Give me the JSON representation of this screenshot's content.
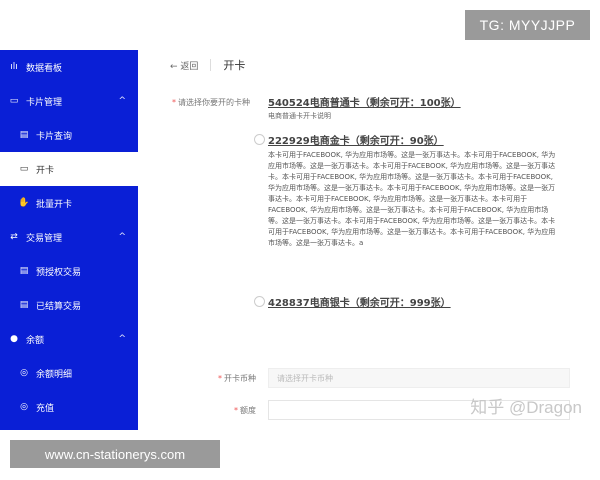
{
  "badges": {
    "tg": "TG: MYYJJPP",
    "site": "www.cn-stationerys.com",
    "watermark": "知乎 @Dragon"
  },
  "sidebar": {
    "items": [
      {
        "label": "数据看板",
        "icon": "chart-icon",
        "level": 0,
        "active": false,
        "chevron": false
      },
      {
        "label": "卡片管理",
        "icon": "card-icon",
        "level": 0,
        "active": false,
        "chevron": true
      },
      {
        "label": "卡片查询",
        "icon": "doc-icon",
        "level": 1,
        "active": false,
        "chevron": false
      },
      {
        "label": "开卡",
        "icon": "card-icon",
        "level": 1,
        "active": true,
        "chevron": false
      },
      {
        "label": "批量开卡",
        "icon": "hand-icon",
        "level": 1,
        "active": false,
        "chevron": false
      },
      {
        "label": "交易管理",
        "icon": "swap-icon",
        "level": 0,
        "active": false,
        "chevron": true
      },
      {
        "label": "预授权交易",
        "icon": "doc-icon",
        "level": 1,
        "active": false,
        "chevron": false
      },
      {
        "label": "已结算交易",
        "icon": "doc-icon",
        "level": 1,
        "active": false,
        "chevron": false
      },
      {
        "label": "余额",
        "icon": "dot-icon",
        "level": 0,
        "active": false,
        "chevron": true
      },
      {
        "label": "余额明细",
        "icon": "circle-icon",
        "level": 1,
        "active": false,
        "chevron": false
      },
      {
        "label": "充值",
        "icon": "circle-icon",
        "level": 1,
        "active": false,
        "chevron": false
      }
    ]
  },
  "header": {
    "back": "← 返回",
    "title": "开卡"
  },
  "form": {
    "card_type_label": "请选择你要开的卡种",
    "options": [
      {
        "title": "540524电商普通卡（剩余可开：100张）",
        "desc": "电商普通卡开卡说明"
      },
      {
        "title": "222929电商金卡（剩余可开：90张）",
        "desc": "本卡可用于FACEBOOK, 华为应用市场等。这是一张万事达卡。本卡可用于FACEBOOK, 华为应用市场等。这是一张万事达卡。本卡可用于FACEBOOK, 华为应用市场等。这是一张万事达卡。本卡可用于FACEBOOK, 华为应用市场等。这是一张万事达卡。本卡可用于FACEBOOK, 华为应用市场等。这是一张万事达卡。本卡可用于FACEBOOK, 华为应用市场等。这是一张万事达卡。本卡可用于FACEBOOK, 华为应用市场等。这是一张万事达卡。本卡可用于FACEBOOK, 华为应用市场等。这是一张万事达卡。本卡可用于FACEBOOK, 华为应用市场等。这是一张万事达卡。本卡可用于FACEBOOK, 华为应用市场等。这是一张万事达卡。本卡可用于FACEBOOK, 华为应用市场等。这是一张万事达卡。本卡可用于FACEBOOK, 华为应用市场等。这是一张万事达卡。a"
      },
      {
        "title": "428837电商银卡（剩余可开：999张）",
        "desc": ""
      }
    ],
    "currency_label": "开卡币种",
    "currency_placeholder": "请选择开卡币种",
    "amount_label": "额度"
  },
  "colors": {
    "sidebar_bg": "#0a1fd6",
    "active_bg": "#ffffff"
  }
}
